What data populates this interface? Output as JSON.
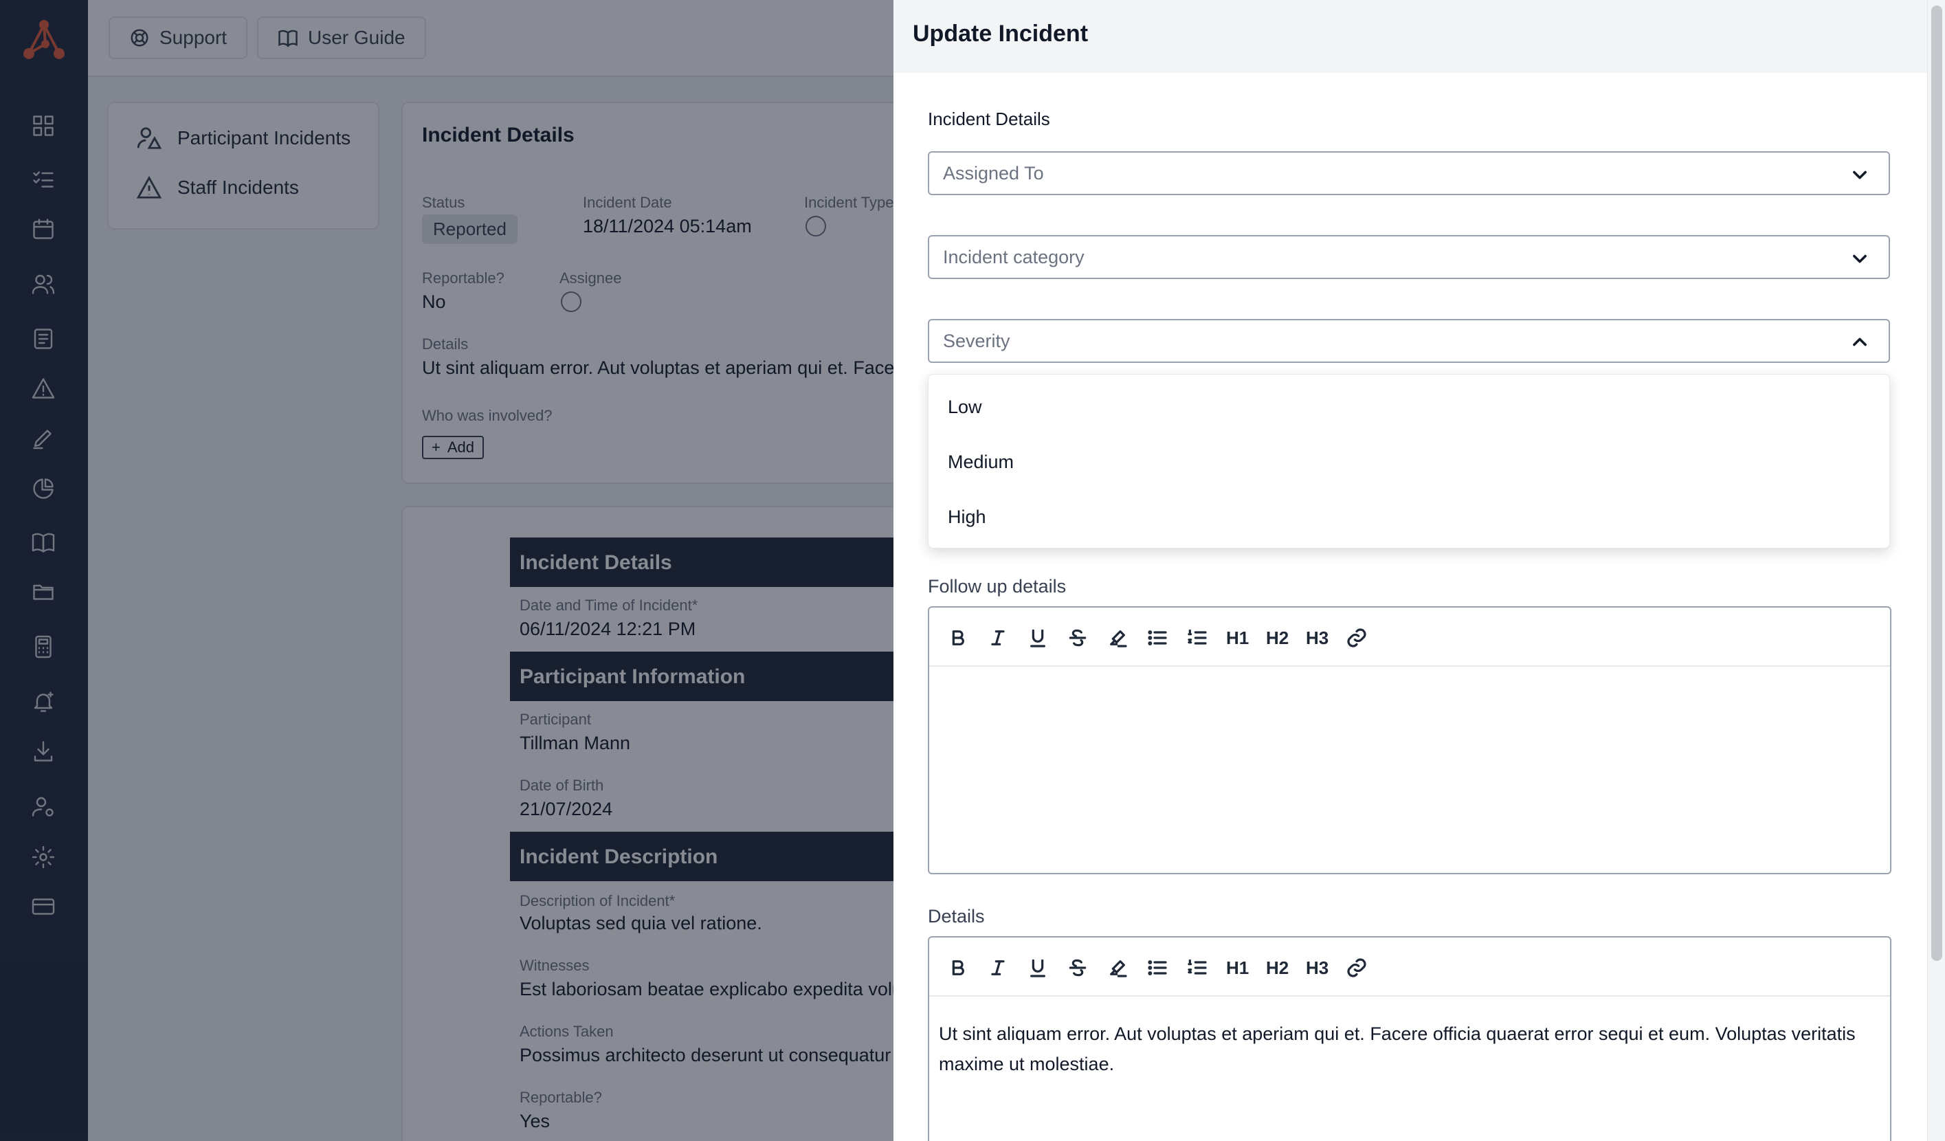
{
  "nav": {
    "icons": [
      "logo-icon",
      "dashboard-icon",
      "checklist-icon",
      "calendar-icon",
      "users-icon",
      "document-list-icon",
      "warning-icon",
      "pen-icon",
      "pie-chart-icon",
      "book-icon",
      "folder-icon",
      "calculator-icon",
      "bell-icon",
      "download-icon",
      "user-settings-icon",
      "gear-icon",
      "credit-card-icon"
    ]
  },
  "topbar": {
    "support_label": "Support",
    "guide_label": "User Guide"
  },
  "side_menu": {
    "participant": "Participant Incidents",
    "staff": "Staff Incidents"
  },
  "incident_card": {
    "title": "Incident Details",
    "status_label": "Status",
    "status_value": "Reported",
    "date_label": "Incident Date",
    "date_value": "18/11/2024 05:14am",
    "type_label": "Incident Type",
    "reportable_label": "Reportable?",
    "reportable_value": "No",
    "assignee_label": "Assignee",
    "details_label": "Details",
    "details_value": "Ut sint aliquam error. Aut voluptas et aperiam qui et. Facer",
    "involved_label": "Who was involved?",
    "add_label": "Add"
  },
  "form_preview": {
    "sec1": "Incident Details",
    "datetime_label": "Date and Time of Incident*",
    "datetime_value": "06/11/2024 12:21 PM",
    "sec2": "Participant Information",
    "participant_label": "Participant",
    "participant_value": "Tillman Mann",
    "dob_label": "Date of Birth",
    "dob_value": "21/07/2024",
    "sec3": "Incident Description",
    "desc_label": "Description of Incident*",
    "desc_value": "Voluptas sed quia vel ratione.",
    "witness_label": "Witnesses",
    "witness_value": "Est laboriosam beatae explicabo expedita volu",
    "actions_label": "Actions Taken",
    "actions_value": "Possimus architecto deserunt ut consequatur",
    "reportable_label": "Reportable?",
    "reportable_value": "Yes"
  },
  "panel": {
    "title": "Update Incident",
    "section": "Incident Details",
    "assigned_placeholder": "Assigned To",
    "category_placeholder": "Incident category",
    "severity_placeholder": "Severity",
    "severity_options": [
      "Low",
      "Medium",
      "High"
    ],
    "follow_label": "Follow up details",
    "details_label": "Details",
    "details_text": "Ut sint aliquam error. Aut voluptas et aperiam qui et. Facere officia quaerat error sequi et eum. Voluptas veritatis maxime ut molestiae.",
    "toolbar": {
      "h1": "H1",
      "h2": "H2",
      "h3": "H3"
    }
  },
  "colors": {
    "rail": "#1e293b",
    "accent": "#e05a3a",
    "overlay": "rgba(17,24,39,0.5)"
  }
}
